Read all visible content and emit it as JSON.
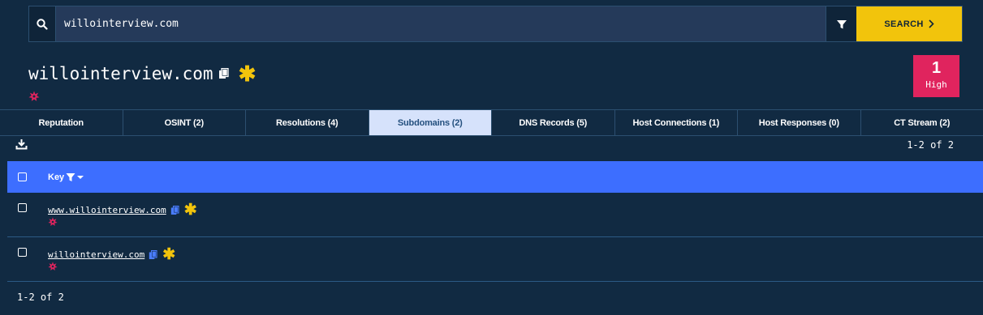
{
  "search": {
    "value": "willointerview.com",
    "button_label": "SEARCH"
  },
  "header": {
    "title": "willointerview.com",
    "risk_score": "1",
    "risk_label": "High"
  },
  "tabs": [
    {
      "label": "Reputation"
    },
    {
      "label": "OSINT (2)"
    },
    {
      "label": "Resolutions (4)"
    },
    {
      "label": "Subdomains (2)",
      "active": true
    },
    {
      "label": "DNS Records (5)"
    },
    {
      "label": "Host Connections (1)"
    },
    {
      "label": "Host Responses (0)"
    },
    {
      "label": "CT Stream (2)"
    }
  ],
  "table": {
    "pager_top": "1-2 of 2",
    "column_key": "Key",
    "rows": [
      {
        "key": "www.willointerview.com"
      },
      {
        "key": "willointerview.com"
      }
    ],
    "pager_bottom": "1-2 of 2"
  },
  "colors": {
    "background": "#112a42",
    "accent_yellow": "#f2c40c",
    "risk_red": "#e0245e",
    "header_blue": "#3d6eff",
    "active_tab": "#d6e2fb"
  },
  "icons": [
    "search-icon",
    "filter-icon",
    "chevron-right-icon",
    "copy-icon",
    "asterisk-icon",
    "burst-icon",
    "download-icon",
    "checkbox-icon",
    "sort-caret-icon"
  ]
}
